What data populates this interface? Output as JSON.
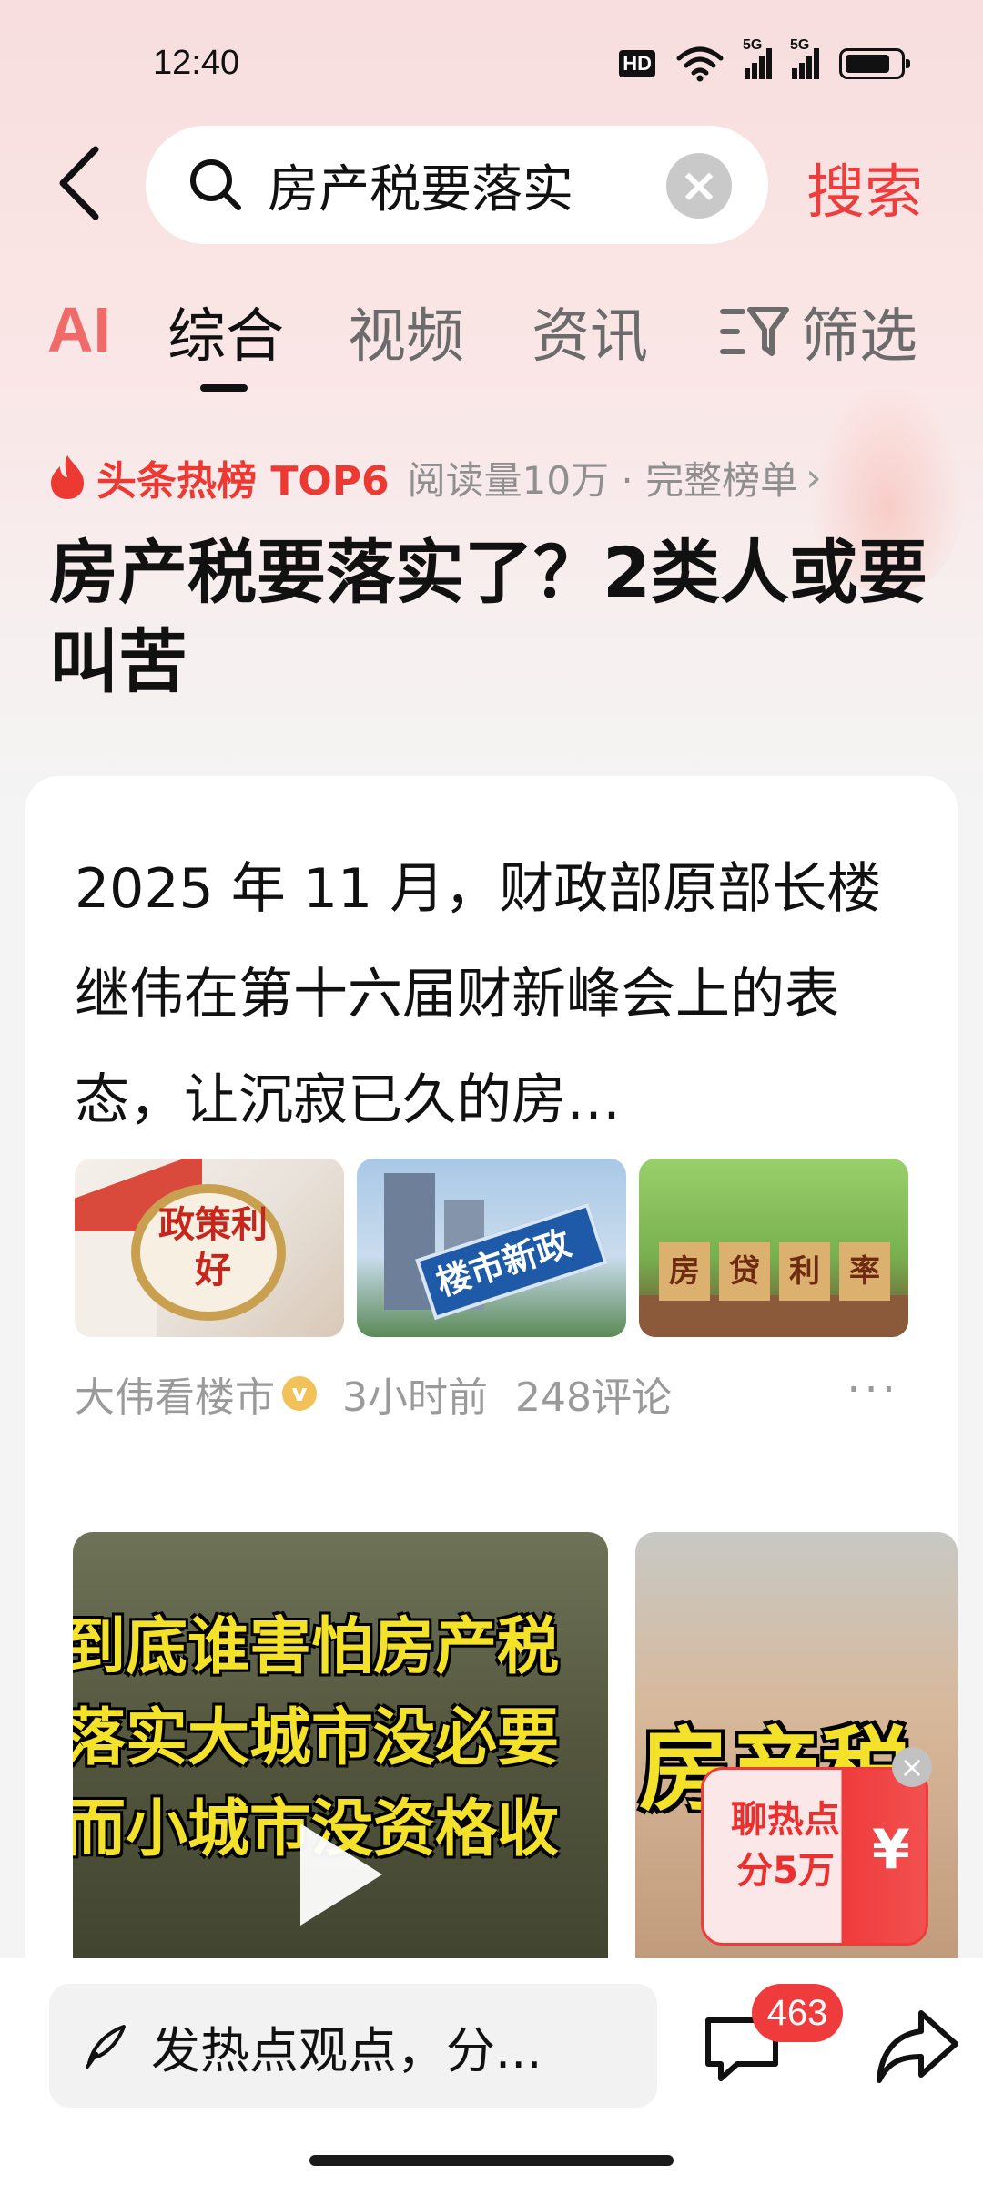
{
  "status_bar": {
    "time": "12:40",
    "hd": "HD",
    "signal_1": "5G",
    "signal_2": "5G"
  },
  "search": {
    "query": "房产税要落实",
    "clear_glyph": "×",
    "submit_label": "搜索"
  },
  "tabs": {
    "ai_label": "AI",
    "items": [
      "综合",
      "视频",
      "资讯",
      "筛选"
    ],
    "active_index": 0
  },
  "hot": {
    "label": "头条热榜 TOP6",
    "meta": "阅读量10万 · 完整榜单",
    "arrow": "›"
  },
  "topic": {
    "title": "房产税要落实了？2类人或要叫苦"
  },
  "article": {
    "snippet": "2025 年 11 月，财政部原部长楼继伟在第十六届财新峰会上的表态，让沉寂已久的房…",
    "images": [
      {
        "caption": "政策利好"
      },
      {
        "caption": "楼市新政"
      },
      {
        "caption": "房贷利率",
        "chars": [
          "房",
          "贷",
          "利",
          "率"
        ]
      }
    ],
    "author": "大伟看楼市",
    "verified_glyph": "v",
    "time": "3小时前",
    "comments": "248评论",
    "more": "···"
  },
  "videos": [
    {
      "captions": [
        "到底谁害怕房产税",
        "落实大城市没必要",
        "而小城市没资格收"
      ]
    },
    {
      "caption": "房产税"
    }
  ],
  "promo": {
    "text": "聊热点分5万",
    "yen": "¥",
    "close": "×"
  },
  "bottom": {
    "comment_placeholder": "发热点观点，分...",
    "comment_count": "463"
  },
  "colors": {
    "accent": "#ef3b3b",
    "hot_red": "#ec3a33",
    "text_muted": "#8f8f8f"
  }
}
